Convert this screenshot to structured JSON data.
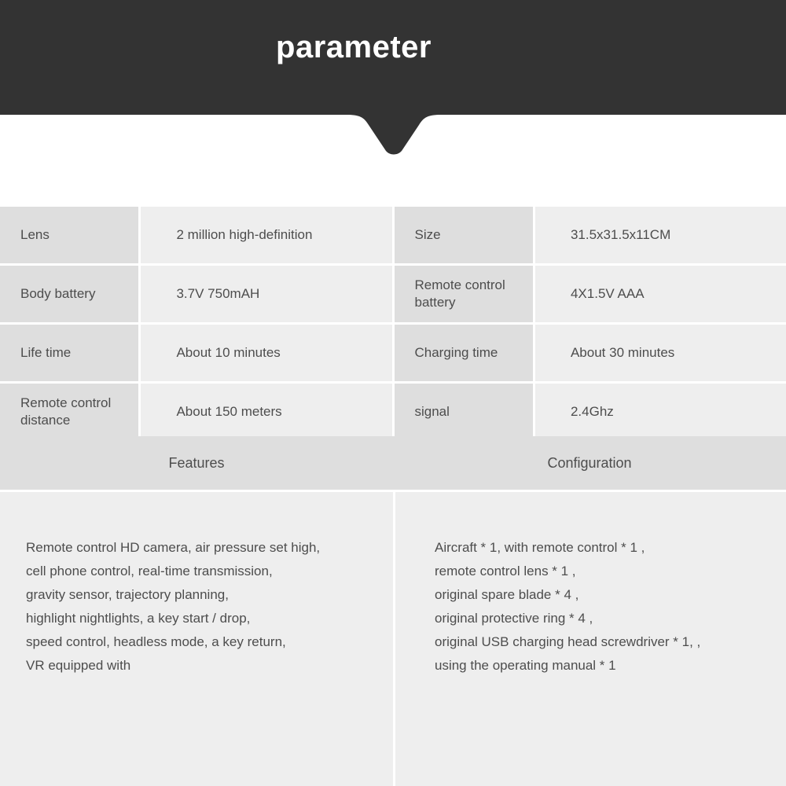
{
  "banner": {
    "title": "parameter",
    "background_color": "#333333",
    "text_color": "#ffffff"
  },
  "spec_table": {
    "label_bg_color": "#dedede",
    "value_bg_color": "#eeeeee",
    "text_color": "#4d4d4d",
    "rows": [
      {
        "left_label": "Lens",
        "left_value": "2 million high-definition",
        "right_label": "Size",
        "right_value": "31.5x31.5x11CM"
      },
      {
        "left_label": "Body battery",
        "left_value": "3.7V 750mAH",
        "right_label": "Remote control battery",
        "right_value": "4X1.5V AAA"
      },
      {
        "left_label": "Life time",
        "left_value": "About 10 minutes",
        "right_label": "Charging time",
        "right_value": "About 30 minutes"
      },
      {
        "left_label": "Remote control distance",
        "left_value": "About 150 meters",
        "right_label": "signal",
        "right_value": "2.4Ghz"
      }
    ]
  },
  "sections": {
    "features_heading": "Features",
    "configuration_heading": "Configuration",
    "features_body": "Remote control HD camera, air pressure set high,\ncell phone control, real-time transmission,\ngravity sensor, trajectory planning,\nhighlight nightlights, a key start / drop,\nspeed control, headless mode, a key return,\nVR equipped with",
    "configuration_body": "Aircraft * 1, with remote control * 1 ,\nremote control lens * 1 ,\noriginal spare blade * 4 ,\noriginal protective ring * 4 ,\noriginal USB charging head screwdriver * 1, ,\nusing the operating manual * 1"
  }
}
